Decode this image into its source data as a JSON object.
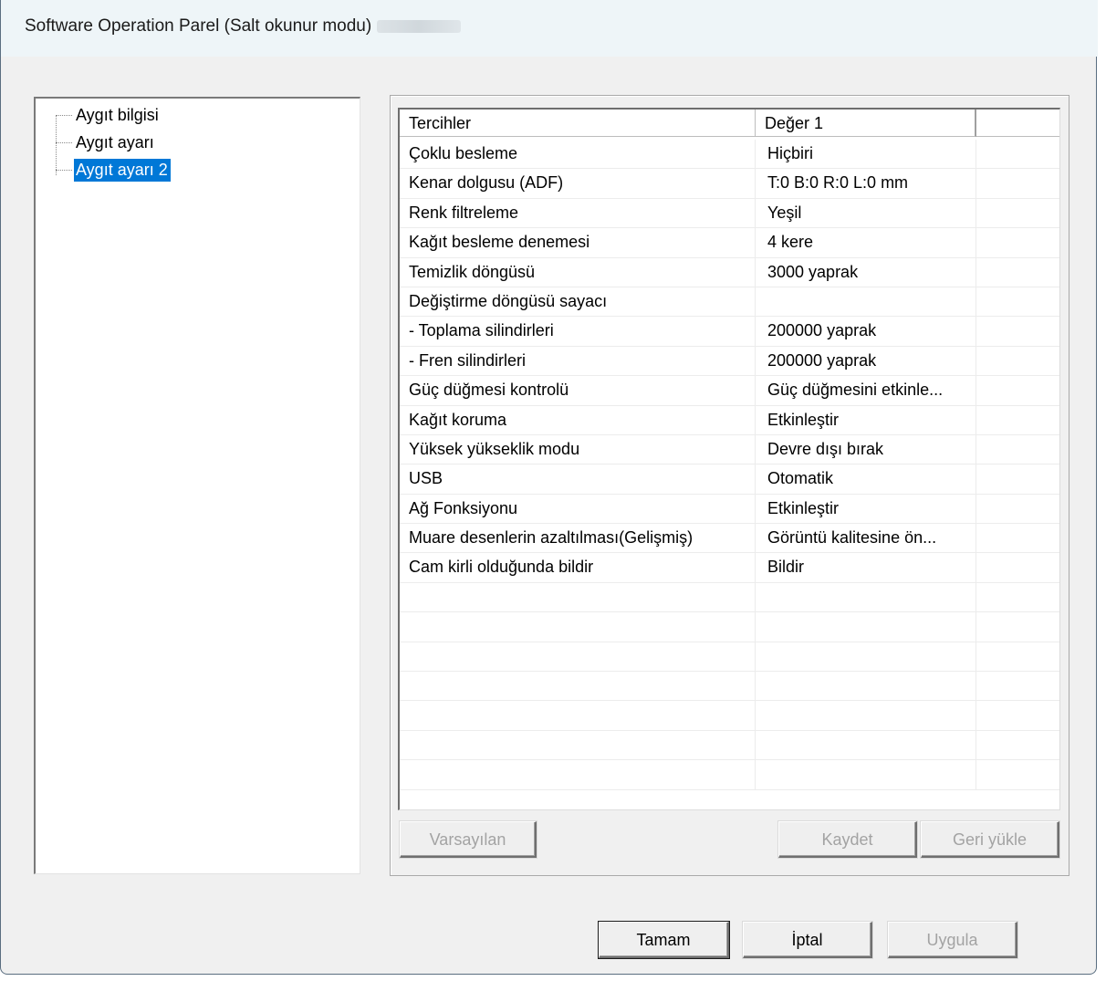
{
  "window": {
    "title": "Software Operation Parel (Salt okunur modu)"
  },
  "tree": {
    "items": [
      {
        "label": "Aygıt bilgisi",
        "selected": false
      },
      {
        "label": "Aygıt ayarı",
        "selected": false
      },
      {
        "label": "Aygıt ayarı 2",
        "selected": true
      }
    ]
  },
  "table": {
    "columns": [
      "Tercihler",
      "Değer 1",
      ""
    ],
    "rows": [
      [
        "Çoklu besleme",
        "Hiçbiri"
      ],
      [
        "Kenar dolgusu (ADF)",
        "T:0 B:0 R:0 L:0 mm"
      ],
      [
        "Renk filtreleme",
        "Yeşil"
      ],
      [
        "Kağıt besleme denemesi",
        "4 kere"
      ],
      [
        "Temizlik döngüsü",
        "3000 yaprak"
      ],
      [
        "Değiştirme döngüsü sayacı",
        ""
      ],
      [
        " - Toplama silindirleri",
        "200000 yaprak"
      ],
      [
        " - Fren silindirleri",
        "200000 yaprak"
      ],
      [
        "Güç düğmesi kontrolü",
        "Güç düğmesini etkinle..."
      ],
      [
        "Kağıt koruma",
        "Etkinleştir"
      ],
      [
        "Yüksek yükseklik modu",
        "Devre dışı bırak"
      ],
      [
        "USB",
        " Otomatik"
      ],
      [
        "Ağ Fonksiyonu",
        "Etkinleştir"
      ],
      [
        "Muare desenlerin azaltılması(Gelişmiş)",
        "Görüntü kalitesine ön..."
      ],
      [
        "Cam kirli olduğunda bildir",
        "Bildir"
      ],
      [
        "",
        ""
      ],
      [
        "",
        ""
      ],
      [
        "",
        ""
      ],
      [
        "",
        ""
      ],
      [
        "",
        ""
      ],
      [
        "",
        ""
      ],
      [
        "",
        ""
      ]
    ]
  },
  "panel_buttons": {
    "default": "Varsayılan",
    "save": "Kaydet",
    "restore": "Geri yükle"
  },
  "dialog_buttons": {
    "ok": "Tamam",
    "cancel": "İptal",
    "apply": "Uygula"
  }
}
